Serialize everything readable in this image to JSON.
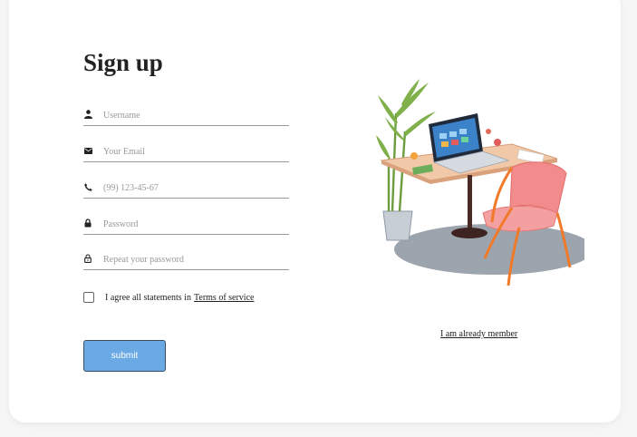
{
  "form": {
    "title": "Sign up",
    "fields": [
      {
        "icon": "person-icon",
        "placeholder": "Username",
        "value": ""
      },
      {
        "icon": "envelope-icon",
        "placeholder": "Your Email",
        "value": ""
      },
      {
        "icon": "phone-icon",
        "placeholder": "(99) 123-45-67",
        "value": ""
      },
      {
        "icon": "lock-icon",
        "placeholder": "Password",
        "value": ""
      },
      {
        "icon": "lock-open-icon",
        "placeholder": "Repeat your password",
        "value": ""
      }
    ],
    "agree_text": "I agree all statements in",
    "terms_link": "Terms of service",
    "agree_checked": false,
    "submit_label": "submit"
  },
  "aside": {
    "member_link": "I am already member"
  },
  "colors": {
    "accent": "#6aa9e4",
    "card": "#ffffff",
    "background": "#f6f6f6"
  }
}
